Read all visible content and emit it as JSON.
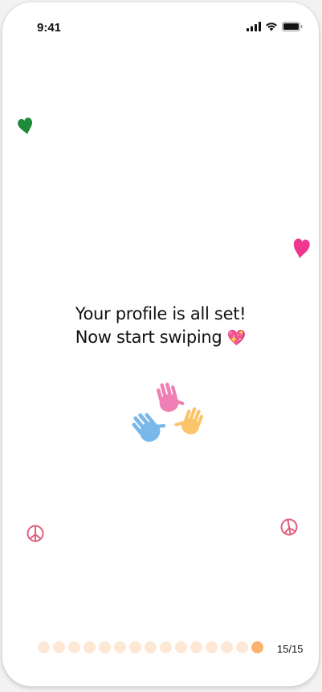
{
  "status_bar": {
    "time": "9:41",
    "icons": [
      "signal-icon",
      "wifi-icon",
      "battery-icon"
    ]
  },
  "message": {
    "line1": "Your profile is all set!",
    "line2": "Now start swiping",
    "line2_emoji": "💖"
  },
  "decorations": [
    "heart-green-icon",
    "heart-pink-icon",
    "peace-left-icon",
    "peace-right-icon",
    "handprints-illustration"
  ],
  "progress": {
    "total_steps": 15,
    "current_step": 15,
    "counter_text": "15/15"
  },
  "colors": {
    "dot_inactive": "#fde8d6",
    "dot_active": "#fbb26e",
    "heart_green": "#1e8a3a",
    "heart_pink": "#f0378f",
    "peace_pink": "#e0607e"
  }
}
